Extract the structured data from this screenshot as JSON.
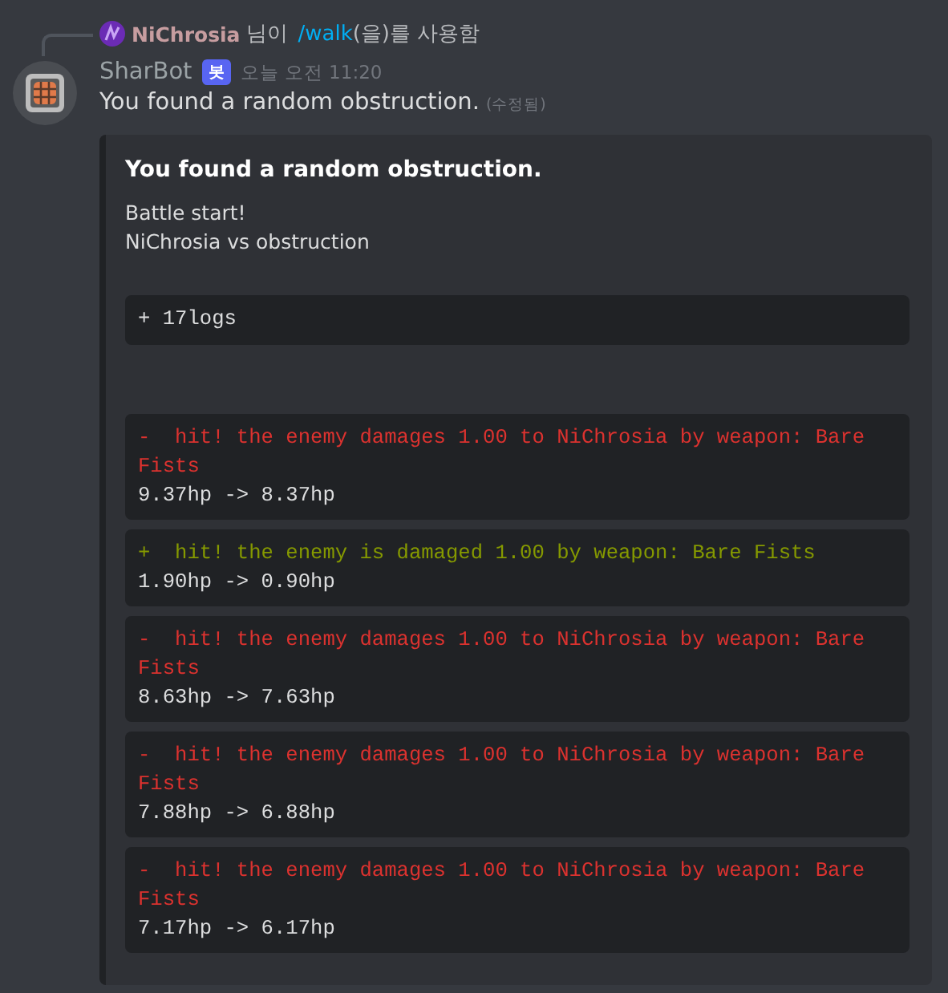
{
  "reply": {
    "user": "NiChrosia",
    "text_before": "님이",
    "command": "/walk",
    "text_after": "(을)를 사용함"
  },
  "message": {
    "author": "SharBot",
    "badge": "봇",
    "timestamp": "오늘 오전 11:20",
    "content": "You found a random obstruction.",
    "edited": "(수정됨)"
  },
  "embed": {
    "title": "You found a random obstruction.",
    "lines": [
      "Battle start!",
      "NiChrosia vs obstruction"
    ],
    "summary": "+ 17logs",
    "logs": [
      {
        "kind": "minus",
        "text": "-  hit! the enemy damages 1.00 to NiChrosia by weapon: Bare Fists",
        "hp": "9.37hp -> 8.37hp"
      },
      {
        "kind": "plus",
        "text": "+  hit! the enemy is damaged 1.00 by weapon: Bare Fists",
        "hp": "1.90hp -> 0.90hp"
      },
      {
        "kind": "minus",
        "text": "-  hit! the enemy damages 1.00 to NiChrosia by weapon: Bare Fists",
        "hp": "8.63hp -> 7.63hp"
      },
      {
        "kind": "minus",
        "text": "-  hit! the enemy damages 1.00 to NiChrosia by weapon: Bare Fists",
        "hp": "7.88hp -> 6.88hp"
      },
      {
        "kind": "minus",
        "text": "-  hit! the enemy damages 1.00 to NiChrosia by weapon: Bare Fists",
        "hp": "7.17hp -> 6.17hp"
      }
    ]
  }
}
